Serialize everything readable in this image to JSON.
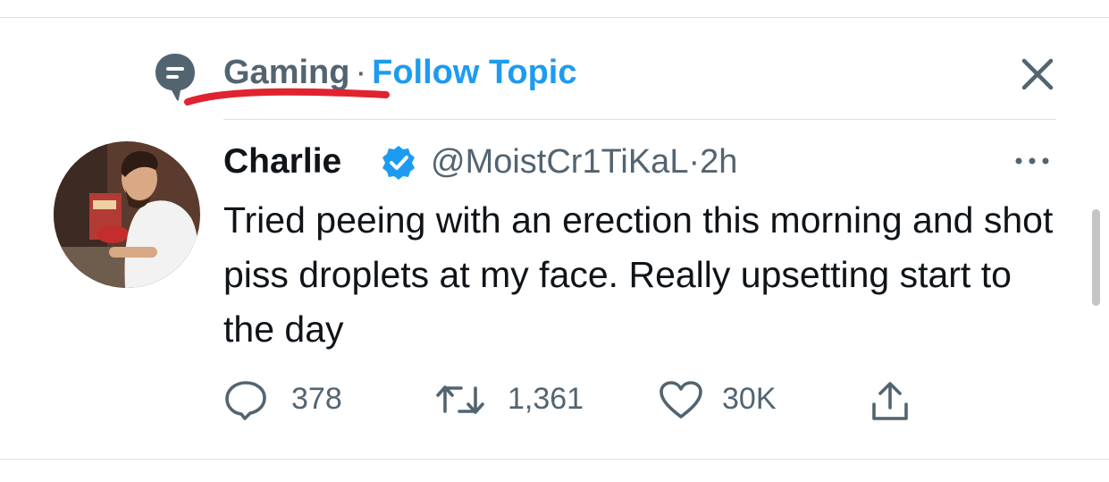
{
  "topic": {
    "name": "Gaming",
    "separator": "·",
    "follow_label": "Follow Topic"
  },
  "tweet": {
    "display_name": "Charlie",
    "handle": "@MoistCr1TiKaL",
    "dot": "·",
    "time": "2h",
    "text": "Tried peeing with an erection this morning and shot piss droplets at my face. Really upsetting start to the day",
    "verified": true
  },
  "actions": {
    "replies": "378",
    "retweets": "1,361",
    "likes": "30K"
  },
  "colors": {
    "accent": "#1d9bf0",
    "secondary_text": "#536471",
    "primary_text": "#0f1419",
    "annotation_red": "#e0232e"
  },
  "icons": [
    "topic-icon",
    "close-icon",
    "verified-badge-icon",
    "more-icon",
    "reply-icon",
    "retweet-icon",
    "like-icon",
    "share-icon"
  ]
}
